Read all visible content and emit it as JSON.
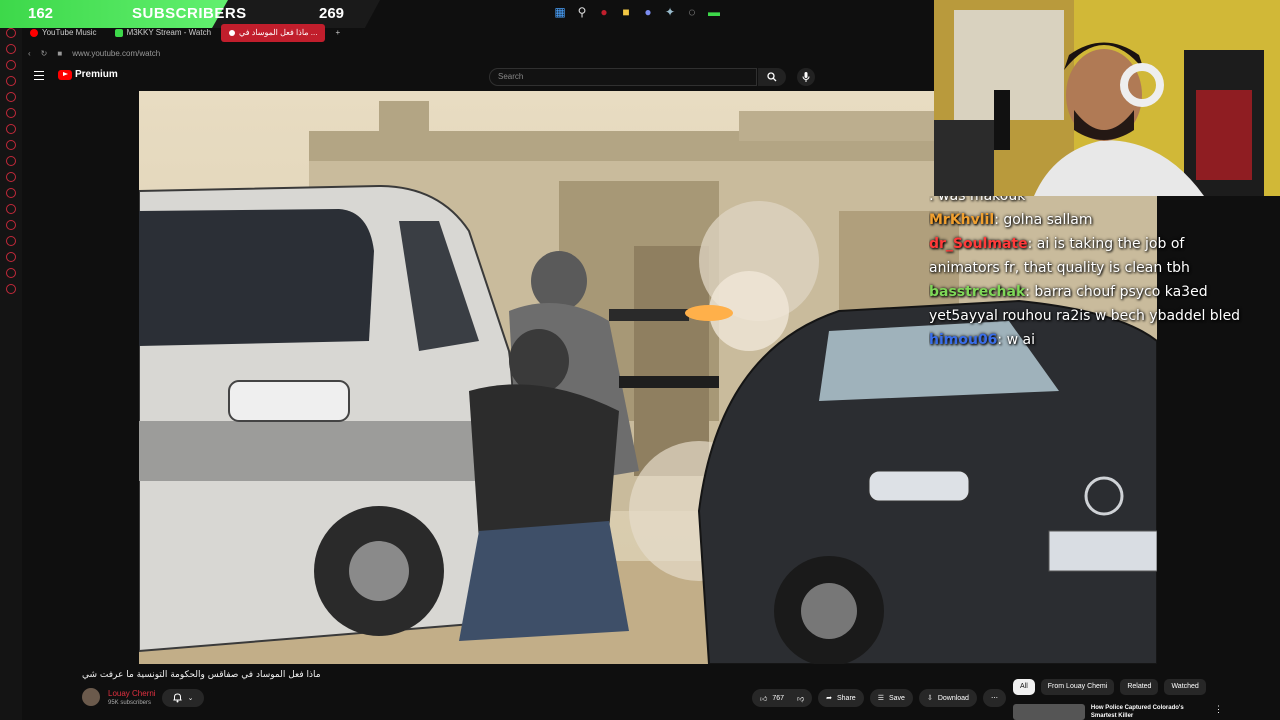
{
  "sub_goal": {
    "current": "162",
    "label": "SUBSCRIBERS",
    "goal": "269",
    "progress_pct": 60
  },
  "browser": {
    "tabs": [
      {
        "label": "YouTube Music",
        "color": "#ff0000",
        "active": false
      },
      {
        "label": "M3KKY Stream - Watch",
        "color": "#3dd84a",
        "active": false
      },
      {
        "label": "ماذا فعل الموساد في ...",
        "color": "#ffffff",
        "active": true
      }
    ],
    "url": "www.youtube.com/watch"
  },
  "youtube": {
    "logo_text": "Premium",
    "search_placeholder": "Search"
  },
  "chat": [
    {
      "user": "",
      "user_color": "#ff3a3a",
      "text": ": was makouk"
    },
    {
      "user": "MrKhvlil",
      "user_color": "#f0a030",
      "text": ": golna sallam"
    },
    {
      "user": "dr_Soulmate",
      "user_color": "#ff3a3a",
      "text": ": ai is taking the job of animators fr, that quality is clean tbh"
    },
    {
      "user": "basstrechak",
      "user_color": "#7fd858",
      "text": ": barra chouf psyco ka3ed yet5ayyal rouhou ra2is w bech ybaddel bled"
    },
    {
      "user": "himou06",
      "user_color": "#3a6ee8",
      "text": ": w ai"
    }
  ],
  "video_info": {
    "title": "ماذا فعل الموساد في صفاقس والحكومة التونسية ما عرفت شي",
    "channel": "Louay Cherni",
    "subscribers": "95K subscribers",
    "likes": "767",
    "share_label": "Share",
    "save_label": "Save",
    "download_label": "Download"
  },
  "sidebar_chips": [
    "All",
    "From Louay Chemi",
    "Related",
    "Watched"
  ],
  "recommendation": {
    "title": "How Police Captured Colorado's Smartest Killer"
  }
}
